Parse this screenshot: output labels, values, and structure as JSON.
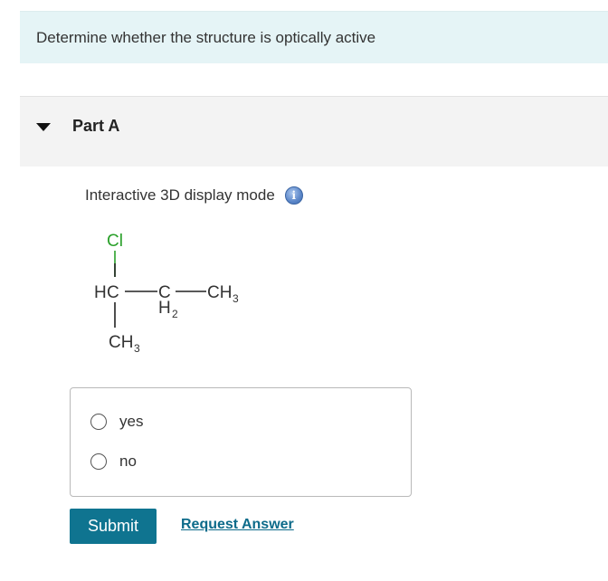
{
  "instruction": {
    "text": "Determine whether the structure is optically active"
  },
  "part": {
    "title": "Part A",
    "expanded": true
  },
  "display_mode": {
    "label": "Interactive 3D display mode",
    "info_icon": "info-icon"
  },
  "structure": {
    "atoms": {
      "top": "Cl",
      "left_h": "H",
      "left_c": "C",
      "mid_c": "C",
      "mid_h": "H",
      "mid_h_sub": "2",
      "right_ch": "CH",
      "right_sub": "3",
      "bottom_ch": "CH",
      "bottom_sub": "3"
    },
    "colors": {
      "chlorine": "#2aa02a",
      "bond": "#222222",
      "text": "#333333"
    }
  },
  "choices": [
    {
      "label": "yes",
      "selected": false
    },
    {
      "label": "no",
      "selected": false
    }
  ],
  "actions": {
    "submit_label": "Submit",
    "request_answer_label": "Request Answer"
  },
  "colors": {
    "banner_bg": "#e5f4f6",
    "part_bg": "#f3f3f3",
    "submit_bg": "#0f7490",
    "link": "#0d6b8a"
  }
}
